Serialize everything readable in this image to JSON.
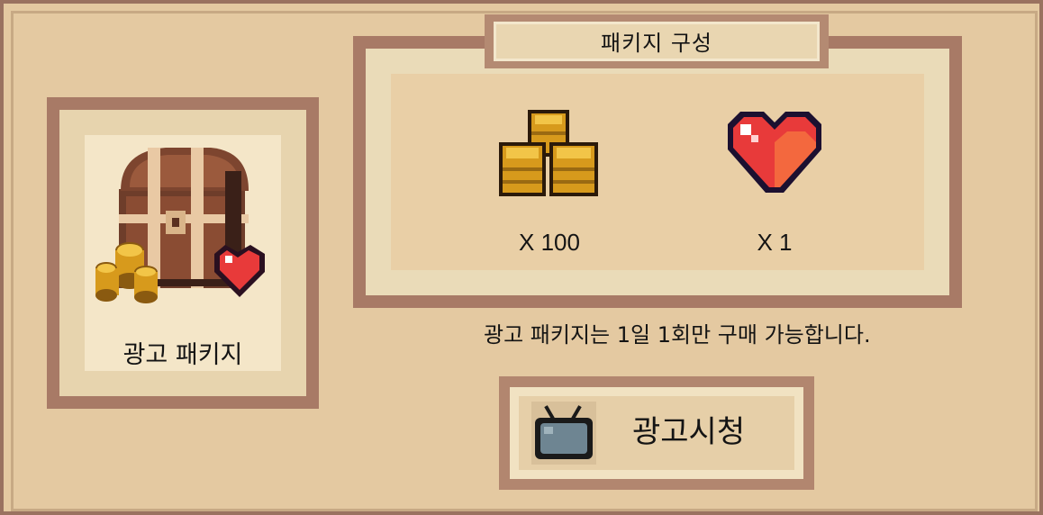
{
  "card": {
    "label": "광고 패키지"
  },
  "contents": {
    "title": "패키지 구성",
    "items": [
      {
        "icon": "coin-stack-icon",
        "label": "X 100"
      },
      {
        "icon": "heart-icon",
        "label": "X 1"
      }
    ]
  },
  "note": "광고 패키지는 1일 1회만 구매 가능합니다.",
  "watch_button": {
    "label": "광고시청",
    "icon": "tv-icon"
  },
  "colors": {
    "panel_bg": "#e4c9a1",
    "frame": "#9a7260",
    "heart": "#e83a3a",
    "coin": "#d79a1c"
  }
}
